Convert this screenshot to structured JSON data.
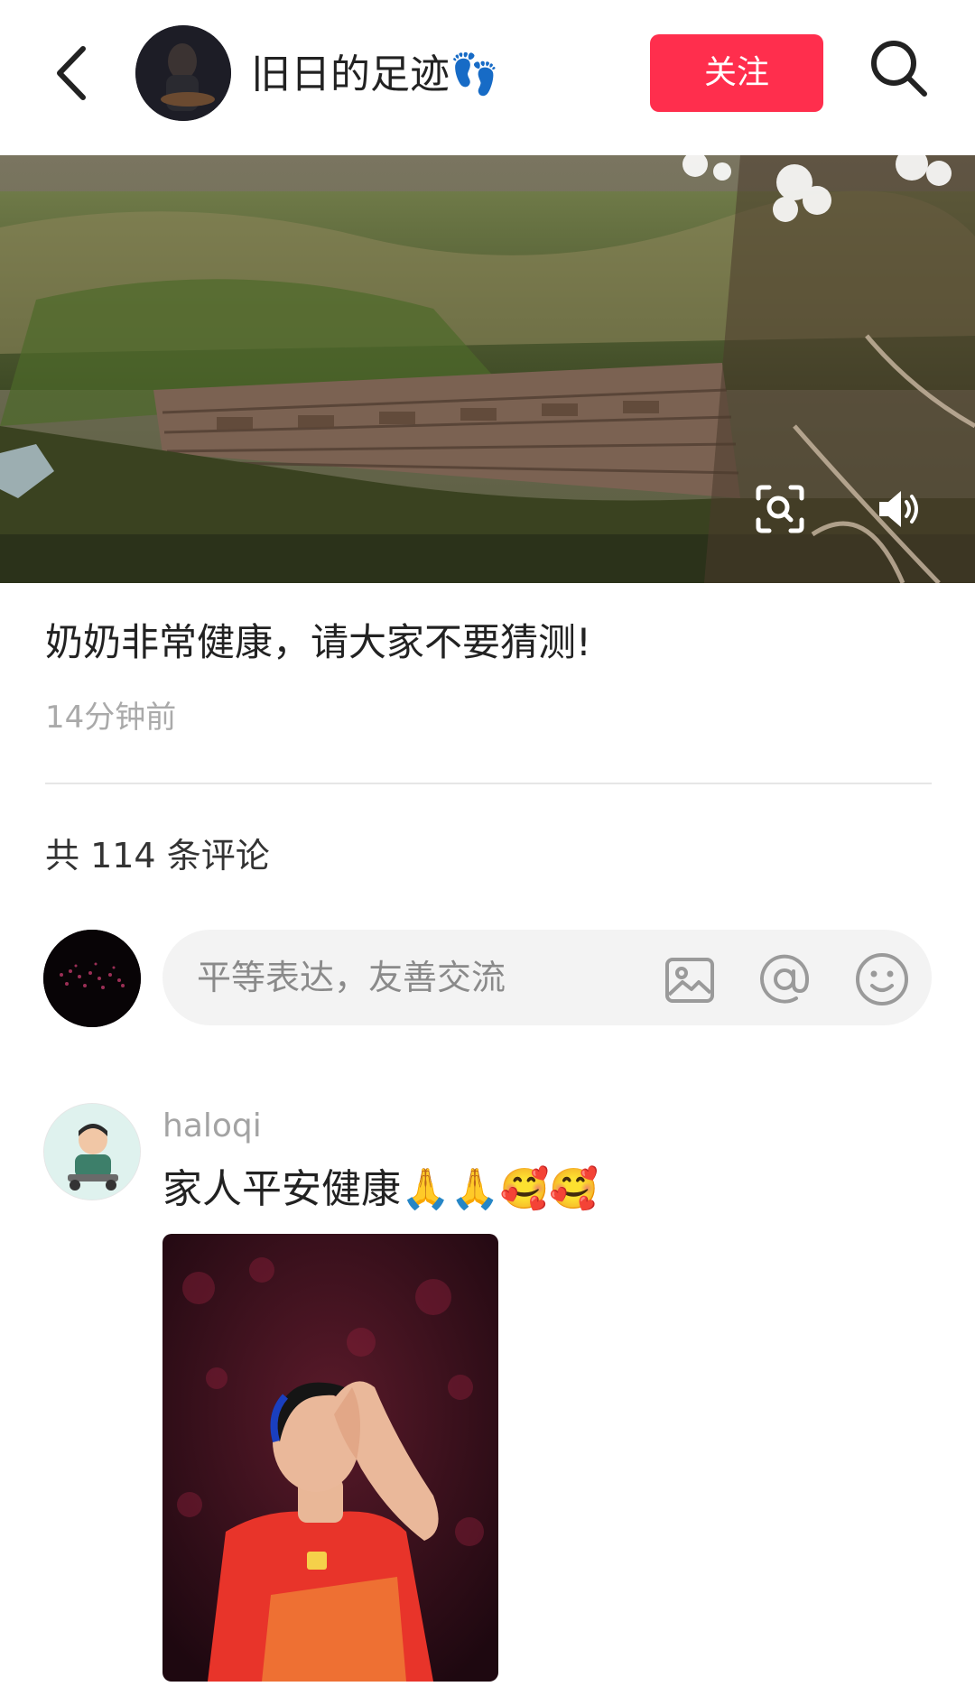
{
  "header": {
    "author_name": "旧日的足迹👣",
    "follow_label": "关注"
  },
  "post": {
    "title": "奶奶非常健康，请大家不要猜测!",
    "time": "14分钟前"
  },
  "comments_section": {
    "count_label": "共 114 条评论",
    "input_placeholder": "平等表达，友善交流"
  },
  "comment": {
    "username": "haloqi",
    "text": "家人平安健康🙏🙏🥰🥰"
  },
  "colors": {
    "accent": "#ff2e4d",
    "muted_text": "#aaaaaa"
  },
  "icons": [
    "back-arrow-icon",
    "search-icon",
    "scan-icon",
    "volume-icon",
    "image-icon",
    "at-icon",
    "emoji-icon"
  ]
}
